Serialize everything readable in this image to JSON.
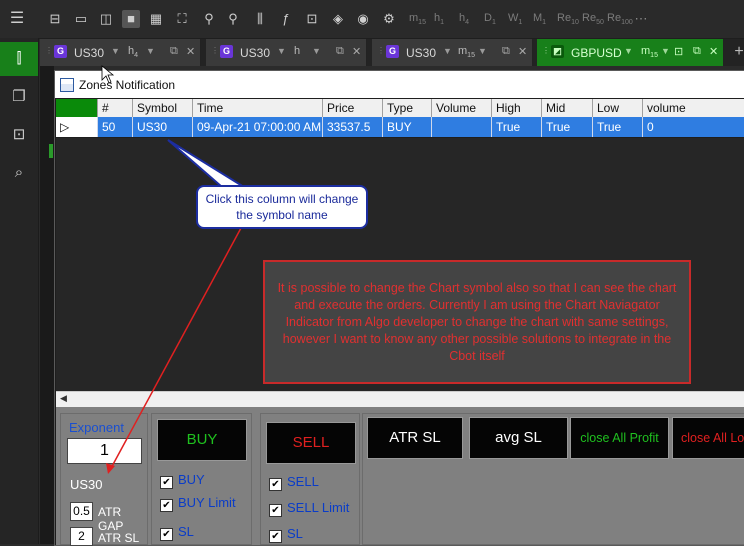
{
  "timeframes": [
    "m",
    "h",
    "h",
    "D",
    "W",
    "M",
    "Re",
    "Re",
    "Re"
  ],
  "timeframe_subs": [
    "15",
    "1",
    "4",
    "1",
    "1",
    "1",
    "10",
    "50",
    "100"
  ],
  "tabs": [
    {
      "badge": "G",
      "symbol": "US30",
      "timeframe": "h",
      "tf_sub": "4",
      "active": false
    },
    {
      "badge": "G",
      "symbol": "US30",
      "timeframe": "h",
      "tf_sub": "",
      "active": false
    },
    {
      "badge": "G",
      "symbol": "US30",
      "timeframe": "m",
      "tf_sub": "15",
      "active": false
    },
    {
      "badge": "",
      "symbol": "GBPUSD",
      "timeframe": "m",
      "tf_sub": "15",
      "active": true
    }
  ],
  "window": {
    "title": "Zones Notification"
  },
  "grid": {
    "columns": [
      "#",
      "Symbol",
      "Time",
      "Price",
      "Type",
      "Volume",
      "High",
      "Mid",
      "Low",
      "volume"
    ],
    "row": [
      "50",
      "US30",
      "09-Apr-21 07:00:00 AM",
      "33537.5",
      "BUY",
      "",
      "True",
      "True",
      "True",
      "0"
    ]
  },
  "panel": {
    "exponent_label": "Exponent",
    "exponent_value": "1",
    "symbol_label": "US30",
    "atr_gap_value": "0.5",
    "atr_gap_label": "ATR GAP",
    "atr_sl_value": "2",
    "atr_sl_label": "ATR SL",
    "buy_button": "BUY",
    "buy_checks": [
      "BUY",
      "BUY Limit",
      "SL"
    ],
    "sell_button": "SELL",
    "sell_checks": [
      "SELL",
      "SELL Limit",
      "SL"
    ],
    "atr_sl_button": "ATR SL",
    "avg_sl_button": "avg SL",
    "close_profit_button": "close All Profit",
    "close_loss_button": "close All Lo"
  },
  "annotations": {
    "bubble": "Click this column will change the symbol name",
    "note": "It is possible to change the Chart symbol also so that I can see the chart and execute the orders. Currently I am using the Chart Naviagator Indicator from Algo developer to change the chart with same settings, however I want to know any other possible solutions to integrate in the Cbot itself"
  },
  "colors": {
    "accent_green": "#18801a",
    "selection_blue": "#2f7de1",
    "annotation_red": "#c82a2a",
    "bubble_blue": "#1c2da0"
  }
}
